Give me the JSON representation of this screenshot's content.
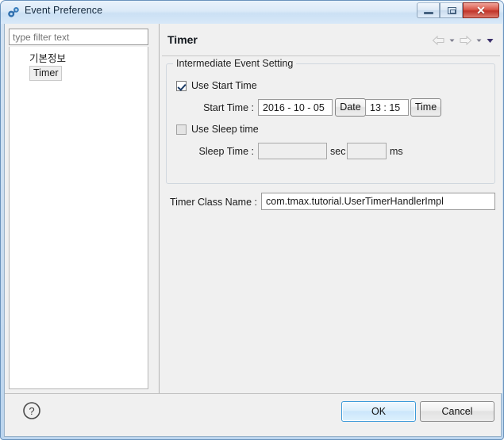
{
  "window": {
    "title": "Event Preference",
    "icon": "preference-icon",
    "controls": {
      "minimize": "minimize-icon",
      "maximize": "maximize-icon",
      "close": "✕"
    }
  },
  "sidebar": {
    "filter": {
      "value": "",
      "placeholder": "type filter text"
    },
    "tree": [
      {
        "label": "기본정보",
        "selected": false
      },
      {
        "label": "Timer",
        "selected": true
      }
    ]
  },
  "page": {
    "title": "Timer",
    "nav": {
      "back": "back-arrow-icon",
      "back_menu": "chevron-down-icon",
      "forward": "forward-arrow-icon",
      "forward_menu": "chevron-down-icon",
      "menu": "chevron-down-icon"
    },
    "group": {
      "legend": "Intermediate Event Setting",
      "use_start_time": {
        "label": "Use Start Time",
        "checked": true
      },
      "start_time": {
        "label": "Start Time :",
        "date_value": "2016 - 10 - 05",
        "date_button": "Date",
        "time_value": "13 : 15",
        "time_button": "Time"
      },
      "use_sleep_time": {
        "label": "Use Sleep time",
        "checked": false
      },
      "sleep_time": {
        "label": "Sleep Time :",
        "sec_value": "",
        "sec_unit": "sec",
        "ms_value": "",
        "ms_unit": "ms"
      }
    },
    "class_name": {
      "label": "Timer Class Name :",
      "value": "com.tmax.tutorial.UserTimerHandlerImpl"
    }
  },
  "footer": {
    "help": "help-icon",
    "ok": "OK",
    "cancel": "Cancel"
  },
  "colors": {
    "accent": "#3c9ad9",
    "title_gradient_top": "#e9f2fb",
    "close_button": "#c0342a",
    "panel_bg": "#f0f0f0"
  }
}
